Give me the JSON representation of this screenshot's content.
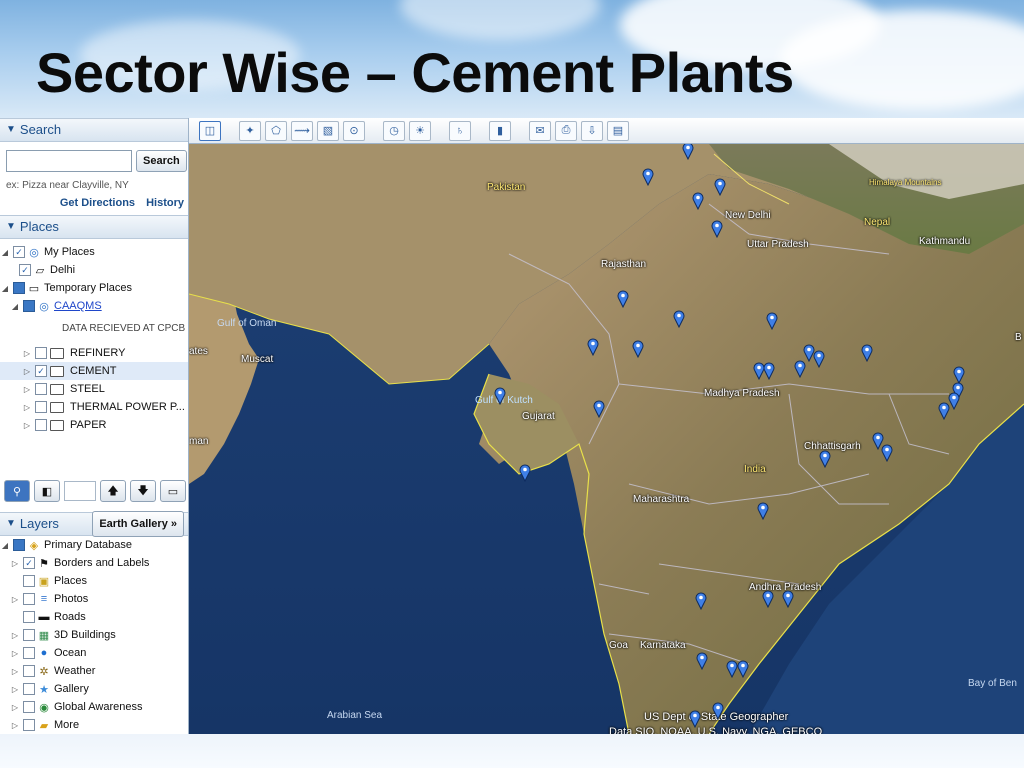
{
  "slide": {
    "title": "Sector Wise – Cement Plants"
  },
  "search_panel": {
    "header": "Search",
    "input_value": "",
    "search_button": "Search",
    "hint": "ex: Pizza near Clayville, NY",
    "get_directions": "Get Directions",
    "history": "History"
  },
  "places_panel": {
    "header": "Places",
    "my_places": "My Places",
    "delhi": "Delhi",
    "temporary_places": "Temporary Places",
    "caaqms": "CAAQMS",
    "note": "DATA RECIEVED AT CPCB",
    "sectors": [
      "REFINERY",
      "CEMENT",
      "STEEL",
      "THERMAL POWER P...",
      "PAPER"
    ],
    "checked_sector": "CEMENT"
  },
  "layers_panel": {
    "header": "Layers",
    "earth_gallery": "Earth Gallery »",
    "primary_database": "Primary Database",
    "items": [
      "Borders and Labels",
      "Places",
      "Photos",
      "Roads",
      "3D Buildings",
      "Ocean",
      "Weather",
      "Gallery",
      "Global Awareness",
      "More"
    ]
  },
  "map": {
    "labels": {
      "pakistan": "Pakistan",
      "delhi": "New Delhi",
      "uttar_pradesh": "Uttar Pradesh",
      "nepal": "Nepal",
      "kathmandu": "Kathmandu",
      "himalaya": "Himalaya Mountains",
      "rajasthan": "Rajasthan",
      "gulf_oman": "Gulf of Oman",
      "muscat": "Muscat",
      "gulf_kutch": "Gulf of Kutch",
      "gujarat": "Gujarat",
      "madhya_pradesh": "Madhya Pradesh",
      "chhattisgarh": "Chhattisgarh",
      "india": "India",
      "maharashtra": "Maharashtra",
      "andhra_pradesh": "Andhra Pradesh",
      "goa": "Goa",
      "karnataka": "Karnataka",
      "bay_of_bengal": "Bay of Ben",
      "arabian_sea": "Arabian Sea",
      "emirates_fragment": "ates",
      "oman_fragment": "man",
      "edge_fragment": "B"
    },
    "credits": [
      "US Dept of State Geographer",
      "Data SIO, NOAA, U.S. Navy, NGA, GEBCO"
    ],
    "pin_color": "#3f7fe6",
    "pins_count": 42
  }
}
